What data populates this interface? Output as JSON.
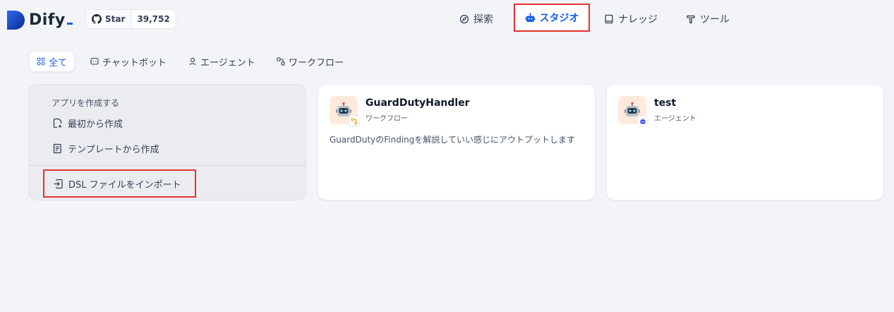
{
  "header": {
    "logo_text": "Dify",
    "github_star_label": "Star",
    "github_star_count": "39,752",
    "nav": {
      "explore": "探索",
      "studio": "スタジオ",
      "knowledge": "ナレッジ",
      "tools": "ツール"
    }
  },
  "filters": {
    "all": "全て",
    "chatbot": "チャットボット",
    "agent": "エージェント",
    "workflow": "ワークフロー"
  },
  "create": {
    "title": "アプリを作成する",
    "blank": "最初から作成",
    "template": "テンプレートから作成",
    "import_dsl": "DSL ファイルをインポート"
  },
  "apps": [
    {
      "name": "GuardDutyHandler",
      "type": "ワークフロー",
      "description": "GuardDutyのFindingを解説していい感じにアウトプットします"
    },
    {
      "name": "test",
      "type": "エージェント",
      "description": ""
    }
  ],
  "colors": {
    "accent": "#155eef",
    "highlight": "#e5322d",
    "avatar_bg": "#ffeadb",
    "background": "#f2f4f7"
  }
}
